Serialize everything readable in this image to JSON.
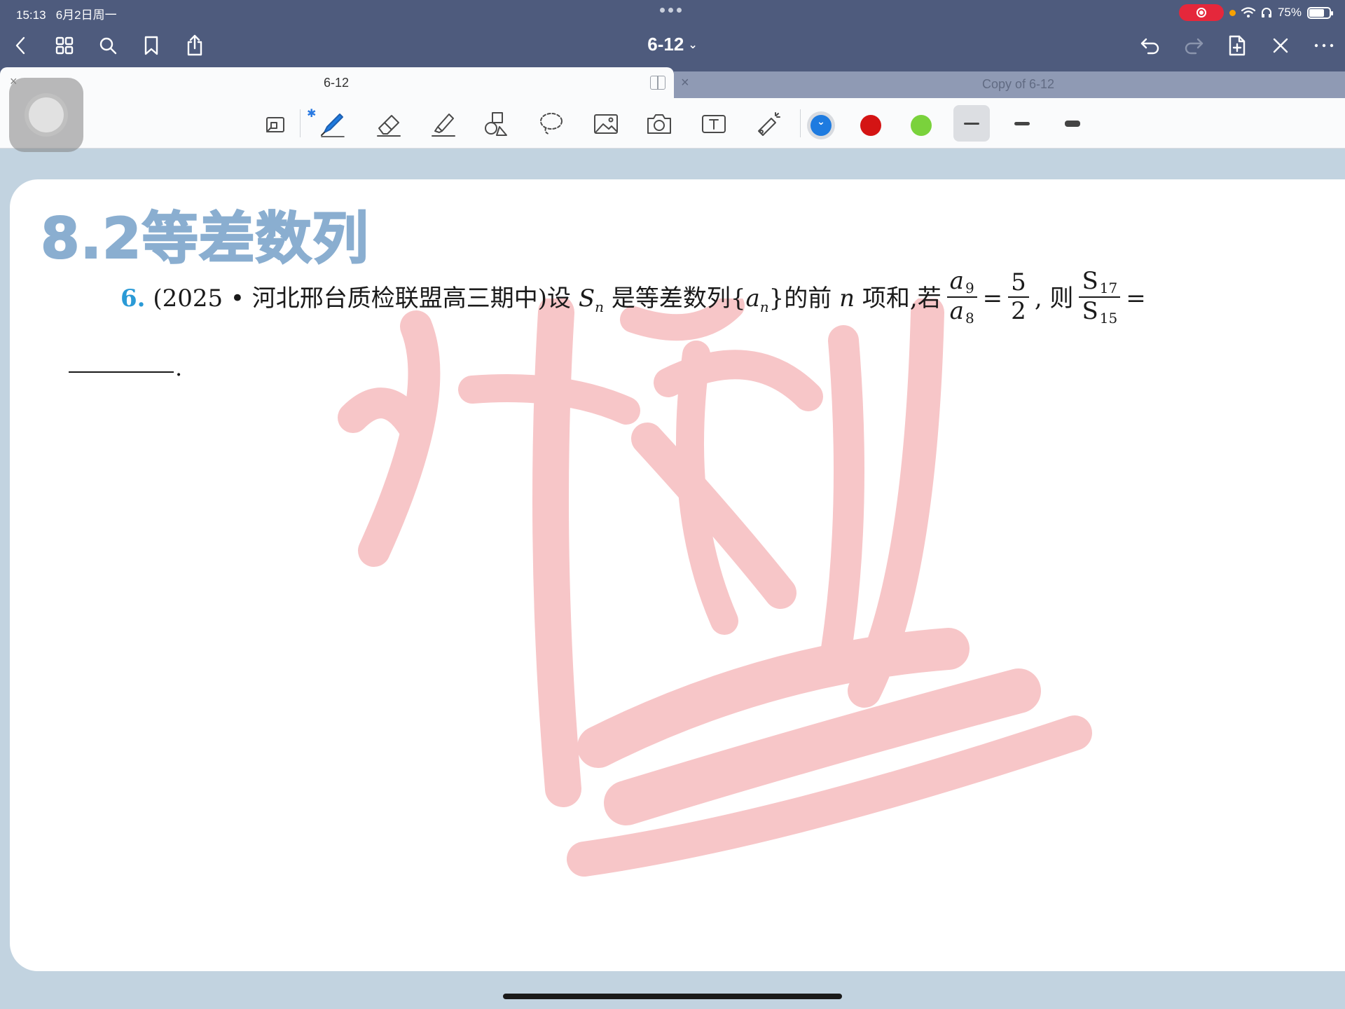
{
  "status": {
    "time": "15:13",
    "date": "6月2日周一",
    "battery": "75%",
    "battery_level": 0.75
  },
  "nav": {
    "title": "6-12",
    "title_chevron": "⌄"
  },
  "tabs": [
    {
      "label": "6-12",
      "close": "×",
      "active": true
    },
    {
      "label": "Copy of 6-12",
      "close": "×",
      "active": false
    }
  ],
  "toolbar": {
    "tools": [
      "page-layout-icon",
      "pen-icon",
      "eraser-icon",
      "highlighter-icon",
      "shapes-icon",
      "lasso-icon",
      "image-icon",
      "camera-icon",
      "text-icon",
      "laser-pointer-icon"
    ],
    "bluetooth_mark": "✱",
    "colors": [
      "#1e7be0",
      "#d41414",
      "#7ad23c"
    ],
    "selected_color": "#1e7be0"
  },
  "document": {
    "section_title": "8.2等差数列",
    "problem": {
      "number": "6.",
      "source": "(2025 • 河北邢台质检联盟高三期中)设 ",
      "S": "S",
      "S_sub": "n",
      "mid1": " 是等差数列{",
      "a": "a",
      "a_sub": "n",
      "mid2": "}的前 ",
      "n": "n",
      "mid3": " 项和,若",
      "frac1_num": "a",
      "frac1_num_sub": "9",
      "frac1_den": "a",
      "frac1_den_sub": "8",
      "eq1": "=",
      "frac2_num": "5",
      "frac2_den": "2",
      "mid4": ", 则",
      "frac3_num": "S",
      "frac3_num_sub": "17",
      "frac3_den": "S",
      "frac3_den_sub": "15",
      "eq2": "=",
      "blank_end": "."
    },
    "watermark_text": "冲刺",
    "watermark_color": "#f7c6c8"
  }
}
